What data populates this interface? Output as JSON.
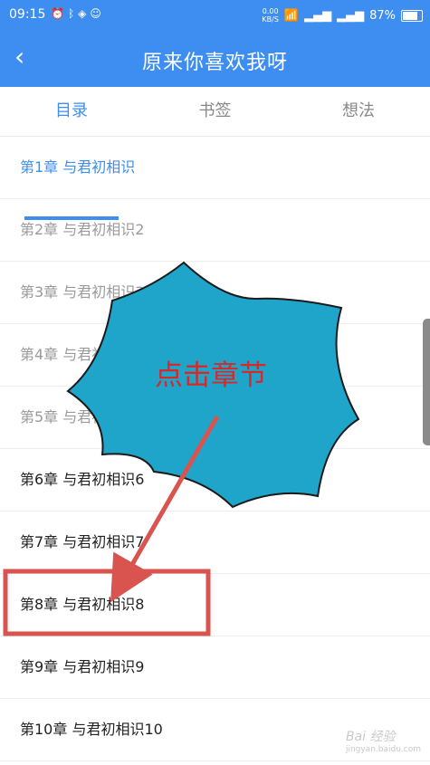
{
  "status_bar": {
    "time": "09:15",
    "icons_left": [
      "alarm-icon",
      "bluetooth-icon",
      "shield-icon",
      "qq-icon"
    ],
    "net_speed_value": "0.00",
    "net_speed_unit": "KB/S",
    "battery": "87%"
  },
  "header": {
    "back_icon": "‹",
    "title": "原来你喜欢我呀"
  },
  "tabs": [
    {
      "label": "目录",
      "active": true
    },
    {
      "label": "书签",
      "active": false
    },
    {
      "label": "想法",
      "active": false
    }
  ],
  "chapters": [
    {
      "label": "第1章 与君初相识",
      "state": "current"
    },
    {
      "label": "第2章 与君初相识2",
      "state": "read"
    },
    {
      "label": "第3章 与君初相识3",
      "state": "read"
    },
    {
      "label": "第4章 与君初相识4",
      "state": "read"
    },
    {
      "label": "第5章 与君初相识5",
      "state": "read"
    },
    {
      "label": "第6章 与君初相识6",
      "state": "unread"
    },
    {
      "label": "第7章 与君初相识7",
      "state": "unread"
    },
    {
      "label": "第8章 与君初相识8",
      "state": "unread"
    },
    {
      "label": "第9章 与君初相识9",
      "state": "unread"
    },
    {
      "label": "第10章 与君初相识10",
      "state": "unread"
    }
  ],
  "annotation": {
    "callout_text": "点击章节",
    "callout_fill": "#1fa5c9",
    "callout_text_color": "#d8282a",
    "highlight_color": "#d9534f"
  },
  "watermark": {
    "brand": "Bai 经验",
    "url": "jingyan.baidu.com"
  },
  "colors": {
    "primary": "#3d8ef0",
    "read_text": "#9a9a9a",
    "text": "#222222"
  }
}
